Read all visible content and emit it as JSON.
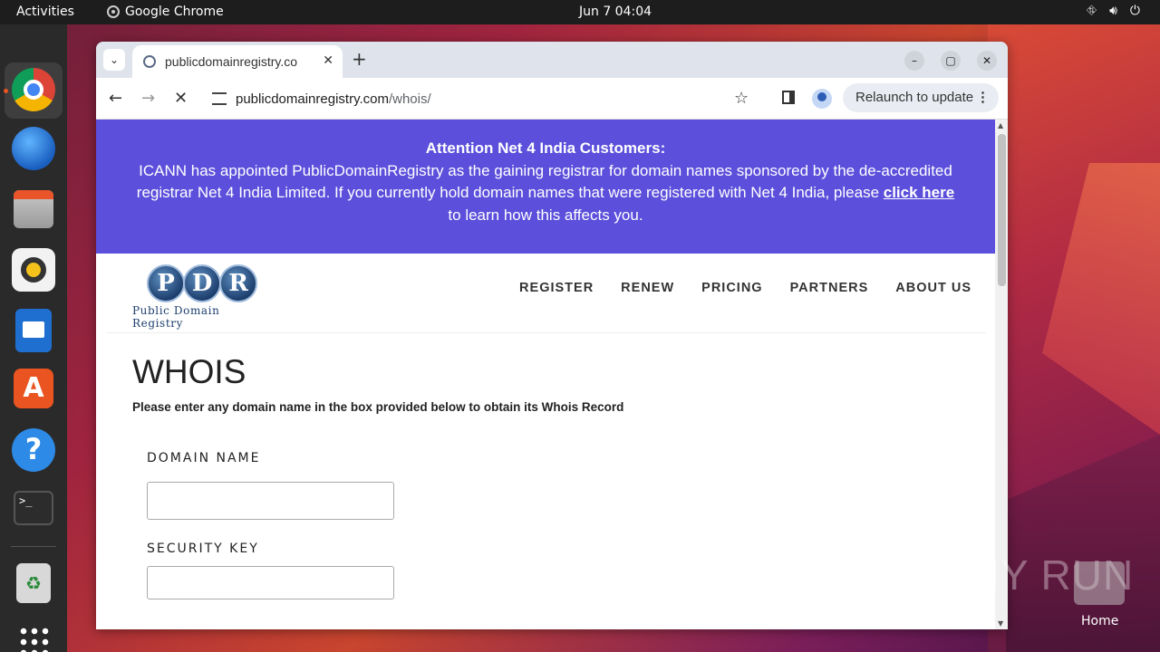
{
  "topbar": {
    "activities": "Activities",
    "app_name": "Google Chrome",
    "clock": "Jun 7  04:04"
  },
  "browser": {
    "tab_title": "publicdomainregistry.co",
    "url_host": "publicdomainregistry.com",
    "url_path": "/whois/",
    "relaunch_label": "Relaunch to update"
  },
  "banner": {
    "title": "Attention Net 4 India Customers:",
    "body_before": "ICANN has appointed PublicDomainRegistry as the gaining registrar for domain names sponsored by the de-accredited registrar Net 4 India Limited. If you currently hold domain names that were registered with Net 4 India, please ",
    "link": "click here",
    "body_after": " to learn how this affects you."
  },
  "logo": {
    "letters": [
      "P",
      "D",
      "R"
    ],
    "text": "Public Domain Registry"
  },
  "nav": {
    "items": [
      "REGISTER",
      "RENEW",
      "PRICING",
      "PARTNERS",
      "ABOUT US"
    ]
  },
  "whois": {
    "title": "WHOIS",
    "description": "Please enter any domain name in the box provided below to obtain its Whois Record",
    "domain_label": "DOMAIN NAME",
    "domain_value": "",
    "security_label": "SECURITY KEY",
    "security_value": ""
  },
  "desktop": {
    "home_label": "Home",
    "watermark": "ANY RUN"
  },
  "colors": {
    "banner_bg": "#5b4fdb",
    "accent": "#e95420"
  }
}
